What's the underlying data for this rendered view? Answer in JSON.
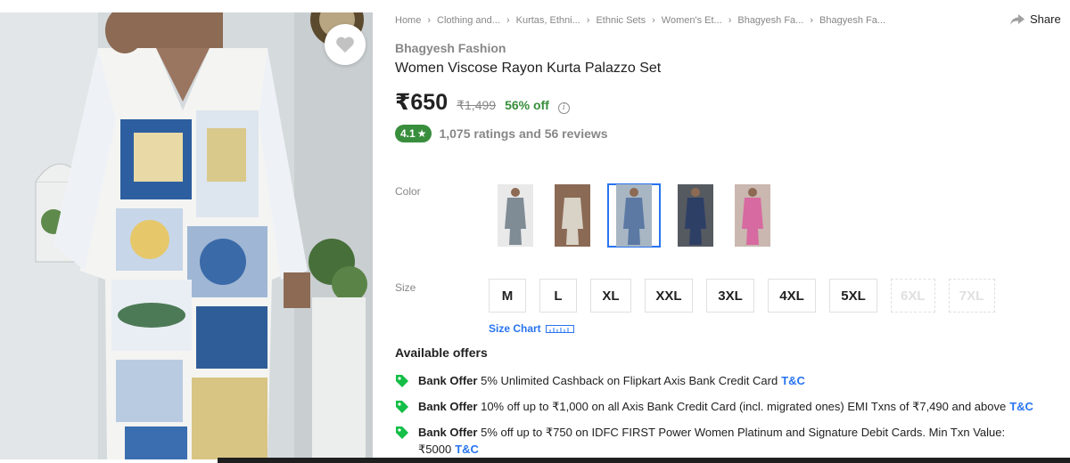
{
  "breadcrumb": [
    "Home",
    "Clothing and...",
    "Kurtas, Ethni...",
    "Ethnic Sets",
    "Women's Et...",
    "Bhagyesh Fa...",
    "Bhagyesh Fa..."
  ],
  "share_label": "Share",
  "product": {
    "brand": "Bhagyesh Fashion",
    "title": "Women Viscose Rayon Kurta Palazzo Set",
    "price": "₹650",
    "mrp": "₹1,499",
    "discount": "56% off",
    "rating": "4.1",
    "rating_star": "★",
    "ratings_reviews": "1,075 ratings and 56 reviews"
  },
  "labels": {
    "color": "Color",
    "size": "Size",
    "size_chart": "Size Chart",
    "available_offers": "Available offers"
  },
  "colors": [
    {
      "name": "grey-set",
      "selected": false,
      "bg": "#e9e9ea",
      "dress": "#7f8b95"
    },
    {
      "name": "brown-set",
      "selected": false,
      "bg": "#8a6a55",
      "dress": "#d9d2c6"
    },
    {
      "name": "blue-print-set",
      "selected": true,
      "bg": "#a8b6c4",
      "dress": "#5b79a3"
    },
    {
      "name": "navy-print-set",
      "selected": false,
      "bg": "#555a60",
      "dress": "#2e3f66"
    },
    {
      "name": "pink-set",
      "selected": false,
      "bg": "#c9b7b0",
      "dress": "#d76aa0"
    }
  ],
  "sizes": [
    {
      "label": "M",
      "available": true
    },
    {
      "label": "L",
      "available": true
    },
    {
      "label": "XL",
      "available": true
    },
    {
      "label": "XXL",
      "available": true
    },
    {
      "label": "3XL",
      "available": true
    },
    {
      "label": "4XL",
      "available": true
    },
    {
      "label": "5XL",
      "available": true
    },
    {
      "label": "6XL",
      "available": false
    },
    {
      "label": "7XL",
      "available": false
    }
  ],
  "offers": [
    {
      "type": "Bank Offer",
      "text": "5% Unlimited Cashback on Flipkart Axis Bank Credit Card",
      "tc": "T&C"
    },
    {
      "type": "Bank Offer",
      "text": "10% off up to ₹1,000 on all Axis Bank Credit Card (incl. migrated ones) EMI Txns of ₹7,490 and above",
      "tc": "T&C"
    },
    {
      "type": "Bank Offer",
      "text": "5% off up to ₹750 on IDFC FIRST Power Women Platinum and Signature Debit Cards. Min Txn Value: ₹5000",
      "tc": "T&C"
    }
  ],
  "colors_theme": {
    "accent": "#2874f0",
    "green": "#388e3c",
    "muted": "#878787"
  }
}
